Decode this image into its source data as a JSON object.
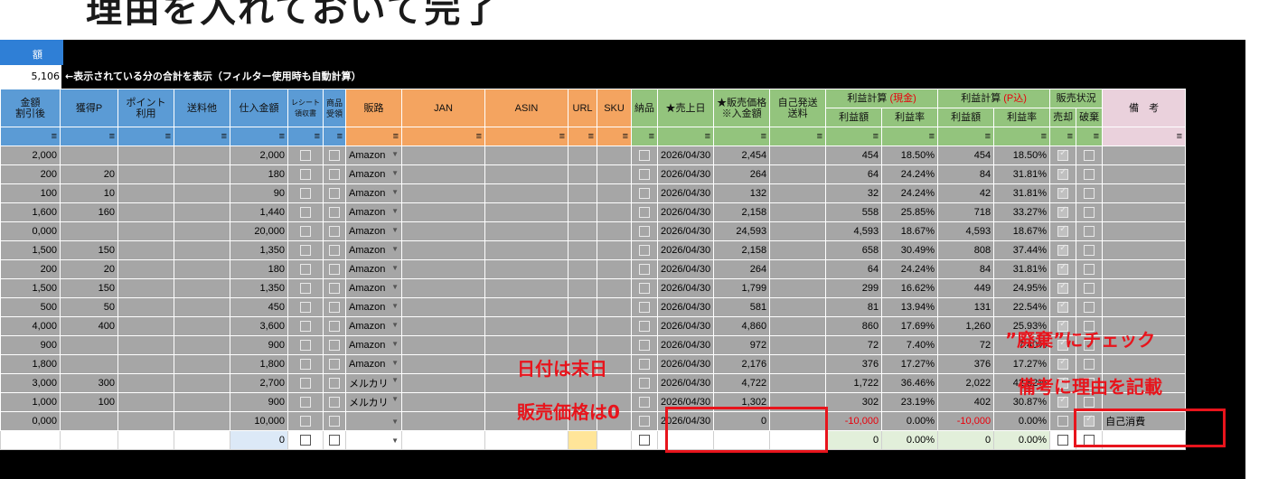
{
  "heading": "理由を入れておいて完了",
  "header_block": {
    "cut_label": "額"
  },
  "summary": {
    "value": "5,106",
    "note": "←表示されている分の合計を表示（フィルター使用時も自動計算）"
  },
  "columns": {
    "discount": [
      "金額",
      "割引後"
    ],
    "points": "獲得P",
    "point_use": [
      "ポイント",
      "利用"
    ],
    "shipping_other": "送料他",
    "purchase": "仕入金額",
    "receipt": [
      "レシート",
      "領収書"
    ],
    "goods_received": [
      "商品",
      "受領"
    ],
    "channel": "販路",
    "jan": "JAN",
    "asin": "ASIN",
    "url": "URL",
    "sku": "SKU",
    "delivered": "納品",
    "sales_date": "★売上日",
    "sale_price": [
      "★販売価格",
      "※入金額"
    ],
    "self_shipping": [
      "自己発送",
      "送料"
    ],
    "profit_cash": "利益計算",
    "profit_cash_tag": "(現金)",
    "profit_p": "利益計算",
    "profit_p_tag": "(P込)",
    "profit_amount": "利益額",
    "profit_rate": "利益率",
    "status": "販売状況",
    "sold": "売却",
    "discarded": "破棄",
    "remarks": "備　考"
  },
  "rows": [
    {
      "disc": "2,000",
      "pts": "",
      "purchase": "2,000",
      "ch": "Amazon",
      "date": "2026/04/30",
      "price": "2,454",
      "pa": "454",
      "pr": "18.50%",
      "pa2": "454",
      "pr2": "18.50%",
      "rem": ""
    },
    {
      "disc": "200",
      "pts": "20",
      "purchase": "180",
      "ch": "Amazon",
      "date": "2026/04/30",
      "price": "264",
      "pa": "64",
      "pr": "24.24%",
      "pa2": "84",
      "pr2": "31.81%",
      "rem": ""
    },
    {
      "disc": "100",
      "pts": "10",
      "purchase": "90",
      "ch": "Amazon",
      "date": "2026/04/30",
      "price": "132",
      "pa": "32",
      "pr": "24.24%",
      "pa2": "42",
      "pr2": "31.81%",
      "rem": ""
    },
    {
      "disc": "1,600",
      "pts": "160",
      "purchase": "1,440",
      "ch": "Amazon",
      "date": "2026/04/30",
      "price": "2,158",
      "pa": "558",
      "pr": "25.85%",
      "pa2": "718",
      "pr2": "33.27%",
      "rem": ""
    },
    {
      "disc": "0,000",
      "pts": "",
      "purchase": "20,000",
      "ch": "Amazon",
      "date": "2026/04/30",
      "price": "24,593",
      "pa": "4,593",
      "pr": "18.67%",
      "pa2": "4,593",
      "pr2": "18.67%",
      "rem": ""
    },
    {
      "disc": "1,500",
      "pts": "150",
      "purchase": "1,350",
      "ch": "Amazon",
      "date": "2026/04/30",
      "price": "2,158",
      "pa": "658",
      "pr": "30.49%",
      "pa2": "808",
      "pr2": "37.44%",
      "rem": ""
    },
    {
      "disc": "200",
      "pts": "20",
      "purchase": "180",
      "ch": "Amazon",
      "date": "2026/04/30",
      "price": "264",
      "pa": "64",
      "pr": "24.24%",
      "pa2": "84",
      "pr2": "31.81%",
      "rem": ""
    },
    {
      "disc": "1,500",
      "pts": "150",
      "purchase": "1,350",
      "ch": "Amazon",
      "date": "2026/04/30",
      "price": "1,799",
      "pa": "299",
      "pr": "16.62%",
      "pa2": "449",
      "pr2": "24.95%",
      "rem": ""
    },
    {
      "disc": "500",
      "pts": "50",
      "purchase": "450",
      "ch": "Amazon",
      "date": "2026/04/30",
      "price": "581",
      "pa": "81",
      "pr": "13.94%",
      "pa2": "131",
      "pr2": "22.54%",
      "rem": ""
    },
    {
      "disc": "4,000",
      "pts": "400",
      "purchase": "3,600",
      "ch": "Amazon",
      "date": "2026/04/30",
      "price": "4,860",
      "pa": "860",
      "pr": "17.69%",
      "pa2": "1,260",
      "pr2": "25.93%",
      "rem": ""
    },
    {
      "disc": "900",
      "pts": "",
      "purchase": "900",
      "ch": "Amazon",
      "date": "2026/04/30",
      "price": "972",
      "pa": "72",
      "pr": "7.40%",
      "pa2": "72",
      "pr2": "7.40%",
      "rem": ""
    },
    {
      "disc": "1,800",
      "pts": "",
      "purchase": "1,800",
      "ch": "Amazon",
      "date": "2026/04/30",
      "price": "2,176",
      "pa": "376",
      "pr": "17.27%",
      "pa2": "376",
      "pr2": "17.27%",
      "rem": ""
    },
    {
      "disc": "3,000",
      "pts": "300",
      "purchase": "2,700",
      "ch": "メルカリ",
      "date": "2026/04/30",
      "price": "4,722",
      "pa": "1,722",
      "pr": "36.46%",
      "pa2": "2,022",
      "pr2": "42.82%",
      "rem": ""
    },
    {
      "disc": "1,000",
      "pts": "100",
      "purchase": "900",
      "ch": "メルカリ",
      "date": "2026/04/30",
      "price": "1,302",
      "pa": "302",
      "pr": "23.19%",
      "pa2": "402",
      "pr2": "30.87%",
      "rem": ""
    },
    {
      "disc": "0,000",
      "pts": "",
      "purchase": "10,000",
      "ch": "",
      "date": "2026/04/30",
      "price": "0",
      "pa": "-10,000",
      "pr": "0.00%",
      "pa2": "-10,000",
      "pr2": "0.00%",
      "rem": "自己消費"
    }
  ],
  "blank_row": {
    "purchase": "0",
    "pa": "0",
    "pr": "0.00%",
    "pa2": "0",
    "pr2": "0.00%"
  },
  "annotations": {
    "date_note": "日付は末日",
    "price_note": "販売価格は0",
    "discard_note": "”廃棄”にチェック",
    "remarks_note": "備考に理由を記載"
  },
  "colors": {
    "accent_red": "#e8141c",
    "header_blue": "#5b9bd5",
    "header_orange": "#f4a460",
    "header_green": "#93c47d",
    "header_pink": "#ead1dc"
  }
}
